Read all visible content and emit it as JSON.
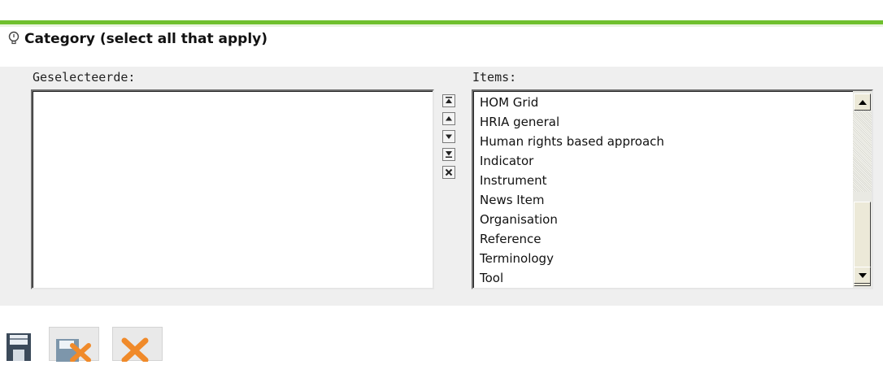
{
  "section": {
    "title": "Category (select all that apply)"
  },
  "selected": {
    "label": "Geselecteerde:",
    "items": []
  },
  "available": {
    "label": "Items:",
    "items": [
      "HOM Grid",
      "HRIA general",
      "Human rights based approach",
      "Indicator",
      "Instrument",
      "News Item",
      "Organisation",
      "Reference",
      "Terminology",
      "Tool"
    ]
  },
  "controls": [
    "move-to-top",
    "move-up",
    "move-down",
    "move-to-bottom",
    "remove"
  ],
  "footer": {
    "buttons": [
      "save-icon",
      "save-cancel-icon",
      "cancel-icon"
    ]
  },
  "colors": {
    "accent_green": "#6fc02d",
    "panel_gray": "#efefef",
    "cancel_orange": "#f08a2a"
  }
}
